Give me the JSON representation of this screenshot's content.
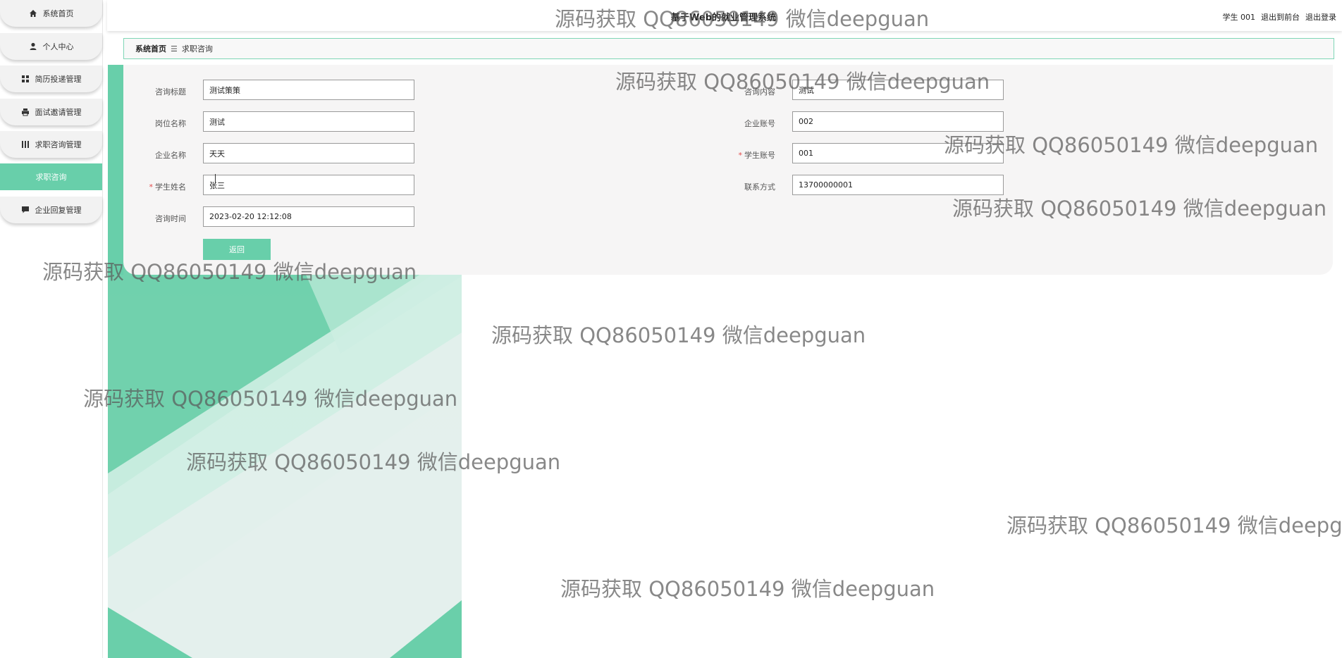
{
  "app": {
    "title": "基于Web的就业管理系统"
  },
  "header": {
    "user_label": "学生 001",
    "to_frontend": "退出到前台",
    "logout": "退出登录"
  },
  "sidebar": {
    "items": [
      {
        "label": "系统首页",
        "icon": "home-icon"
      },
      {
        "label": "个人中心",
        "icon": "person-icon"
      },
      {
        "label": "简历投递管理",
        "icon": "grid-icon"
      },
      {
        "label": "面试邀请管理",
        "icon": "printer-icon"
      },
      {
        "label": "求职咨询管理",
        "icon": "list-icon"
      },
      {
        "label": "企业回复管理",
        "icon": "chat-icon"
      }
    ],
    "sub_item": {
      "label": "求职咨询"
    }
  },
  "breadcrumb": {
    "home": "系统首页",
    "separator": "☰",
    "current": "求职咨询"
  },
  "form": {
    "consult_title": {
      "label": "咨询标题",
      "value": "测试策策",
      "required": false
    },
    "job_name": {
      "label": "岗位名称",
      "value": "测试",
      "required": false
    },
    "company_name": {
      "label": "企业名称",
      "value": "天天",
      "required": false
    },
    "student_name": {
      "label": "学生姓名",
      "value": "张三",
      "required": true
    },
    "consult_time": {
      "label": "咨询时间",
      "value": "2023-02-20 12:12:08",
      "required": false
    },
    "consult_content": {
      "label": "咨询内容",
      "value": "测试",
      "required": false
    },
    "company_account": {
      "label": "企业账号",
      "value": "002",
      "required": false
    },
    "student_account": {
      "label": "学生账号",
      "value": "001",
      "required": true
    },
    "contact": {
      "label": "联系方式",
      "value": "13700000001",
      "required": false
    },
    "back_button": "返回"
  },
  "watermarks": [
    "源码获取 QQ86050149 微信deepguan",
    "源码获取 QQ86050149 微信deepguan",
    "源码获取 QQ86050149 微信deepguan",
    "源码获取 QQ86050149 微信deepguan",
    "源码获取 QQ86050149 微信deepguan",
    "源码获取 QQ86050149 微信deepguan",
    "源码获取 QQ86050149 微信deepguan",
    "源码获取 QQ86050149 微信deepguan",
    "源码获取 QQ86050149 微信deepg",
    "源码获取 QQ86050149 微信deepguan"
  ],
  "colors": {
    "accent": "#68cfaa",
    "accent_dark": "#4fc397",
    "required": "#e24b4b"
  }
}
